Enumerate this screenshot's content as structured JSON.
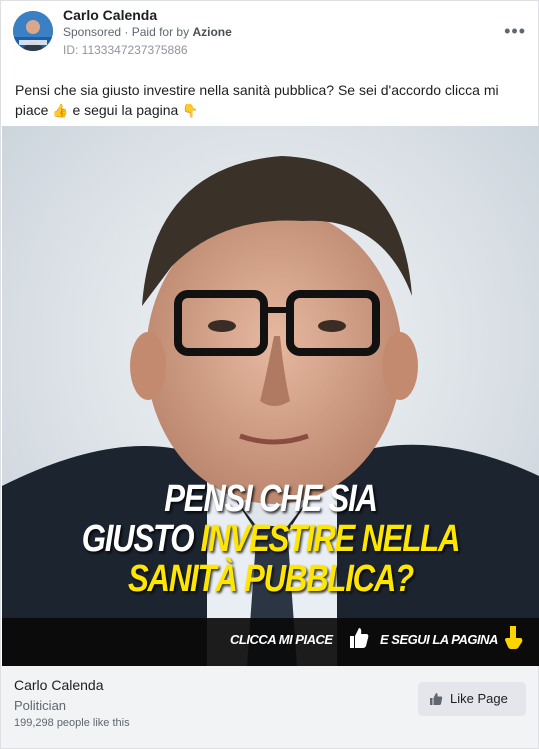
{
  "post": {
    "author": "Carlo Calenda",
    "sponsored_label": "Sponsored",
    "paid_for_prefix": "· Paid for by",
    "paid_for_by": "Azione",
    "ad_id": "ID: 1133347237375886",
    "more_label": "•••",
    "text_part1": "Pensi che sia giusto investire nella sanità pubblica? Se sei d'accordo clicca mi piace",
    "emoji_thumb_up": "👍",
    "text_part2": "e segui la pagina",
    "emoji_point_down": "👇"
  },
  "image": {
    "caption_line1": "PENSI CHE SIA",
    "caption_line2_white": "GIUSTO ",
    "caption_line2_yellow": "INVESTIRE NELLA",
    "caption_line3": "SANITÀ PUBBLICA?",
    "cta_like": "CLICCA MI PIACE",
    "cta_follow": "E SEGUI LA PAGINA"
  },
  "footer": {
    "page_name": "Carlo Calenda",
    "category": "Politician",
    "likes": "199,298 people like this",
    "like_button": "Like Page"
  },
  "colors": {
    "caption_yellow": "#ffe600",
    "footer_bg": "#f2f3f5"
  }
}
